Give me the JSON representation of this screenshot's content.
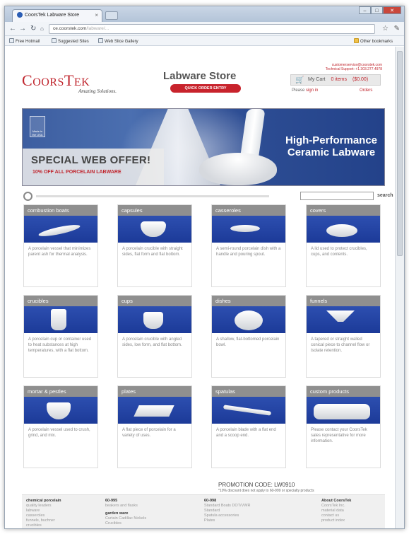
{
  "browser": {
    "tab_title": "CoorsTek Labware Store",
    "tab_close": "×",
    "url_host": "ce.coorstek.com",
    "url_path": "/labware/...",
    "bookmarks": [
      "Free Hotmail",
      "Suggested Sites",
      "Web Slice Gallery"
    ],
    "other_bookmarks": "Other bookmarks",
    "window_controls": [
      "–",
      "□",
      "✕"
    ]
  },
  "header": {
    "logo_text_big": "C",
    "logo_text_small": "OORS",
    "logo_text_big2": "T",
    "logo_text_small2": "EK",
    "tagline": "Amazing Solutions.",
    "store_title": "Labware Store",
    "quick_order": "QUICK ORDER ENTRY",
    "contact_line1": "customerservice@coorstek.com",
    "contact_line2": "Technical Support: +1.303.277.4978",
    "cart_label": "My Cart",
    "cart_items": "0 items",
    "cart_total": "($0.00)",
    "signin_prefix": "Please",
    "signin_link": "sign in",
    "orders_link": "Orders"
  },
  "banner": {
    "badge_text": "Made in the USA",
    "offer_title": "SPECIAL WEB OFFER!",
    "offer_sub": "10% OFF ALL PORCELAIN LABWARE",
    "headline": "High-Performance Ceramic Labware"
  },
  "search": {
    "label": "search",
    "placeholder": ""
  },
  "categories": [
    {
      "title": "combustion boats",
      "desc": "A porcelain vessel that minimizes parent ash for thermal analysis."
    },
    {
      "title": "capsules",
      "desc": "A porcelain crucible with straight sides, flat form and flat bottom."
    },
    {
      "title": "casseroles",
      "desc": "A semi-round porcelain dish with a handle and pouring spout."
    },
    {
      "title": "covers",
      "desc": "A lid used to protect crucibles, cups, and contents."
    },
    {
      "title": "crucibles",
      "desc": "A porcelain cup or container used to heat substances at high temperatures, with a flat bottom."
    },
    {
      "title": "cups",
      "desc": "A porcelain crucible with angled sides, low form, and flat bottom."
    },
    {
      "title": "dishes",
      "desc": "A shallow, flat-bottomed porcelain bowl."
    },
    {
      "title": "funnels",
      "desc": "A tapered or straight walled conical piece to channel flow or isolate retention."
    },
    {
      "title": "mortar & pestles",
      "desc": "A porcelain vessel used to crush, grind, and mix."
    },
    {
      "title": "plates",
      "desc": "A flat piece of porcelain for a variety of uses."
    },
    {
      "title": "spatulas",
      "desc": "A porcelain blade with a flat end and a scoop end."
    },
    {
      "title": "custom products",
      "desc": "Please contact your CoorsTek sales representative for more information."
    }
  ],
  "promo": {
    "code": "PROMOTION CODE: LW0910",
    "note": "*10% discount does not apply to 60-999 or specialty products"
  },
  "footer": {
    "col1": {
      "heading": "chemical porcelain",
      "links": [
        "quality leaders",
        "labware",
        "casseroles",
        "funnels, buchner",
        "crucibles"
      ]
    },
    "col2": {
      "heading": "60-995",
      "links": [
        "beakers and flasks"
      ],
      "heading2": "garden ware",
      "links2": [
        "Curtain Cadillac Nickels",
        "Crucibles"
      ]
    },
    "col3": {
      "heading": "60-998",
      "links": [
        "Standard Boats DOT/VWR",
        "Standard",
        "Spatula accessories",
        "Plates"
      ]
    },
    "col4": {
      "heading": "About CoorsTek",
      "links": [
        "CoorsTek Inc.",
        "material data",
        "contact us",
        "product index"
      ]
    }
  },
  "colors": {
    "brand_red": "#c0262e",
    "category_gray": "#8f8f8f",
    "image_blue": "#2d4fb0"
  }
}
